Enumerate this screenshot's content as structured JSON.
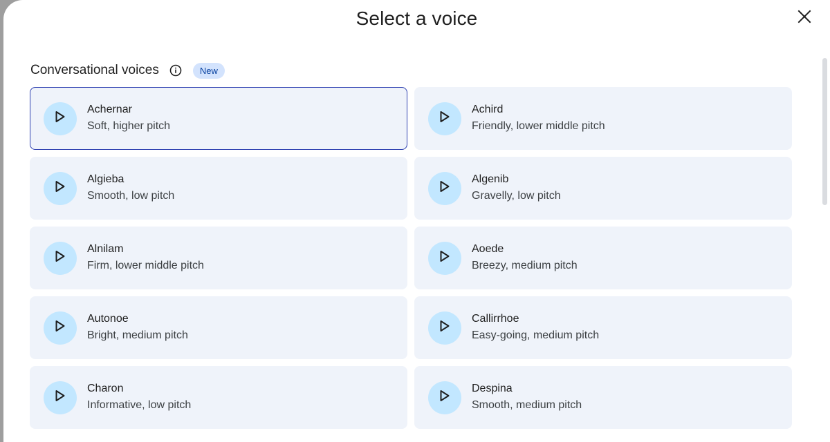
{
  "dialog": {
    "title": "Select a voice",
    "close_icon": "close-icon"
  },
  "section": {
    "title": "Conversational voices",
    "info_icon": "info-icon",
    "badge": "New"
  },
  "voices": [
    {
      "name": "Achernar",
      "description": "Soft, higher pitch",
      "selected": true
    },
    {
      "name": "Achird",
      "description": "Friendly, lower middle pitch",
      "selected": false
    },
    {
      "name": "Algieba",
      "description": "Smooth, low pitch",
      "selected": false
    },
    {
      "name": "Algenib",
      "description": "Gravelly, low pitch",
      "selected": false
    },
    {
      "name": "Alnilam",
      "description": "Firm, lower middle pitch",
      "selected": false
    },
    {
      "name": "Aoede",
      "description": "Breezy, medium pitch",
      "selected": false
    },
    {
      "name": "Autonoe",
      "description": "Bright, medium pitch",
      "selected": false
    },
    {
      "name": "Callirrhoe",
      "description": "Easy-going, medium pitch",
      "selected": false
    },
    {
      "name": "Charon",
      "description": "Informative, low pitch",
      "selected": false
    },
    {
      "name": "Despina",
      "description": "Smooth, medium pitch",
      "selected": false
    }
  ],
  "colors": {
    "card_bg": "#eff3fa",
    "selected_border": "#2c3fb0",
    "play_bg": "#c2e7ff",
    "badge_bg": "#d3e3fd",
    "badge_text": "#0842a0"
  }
}
